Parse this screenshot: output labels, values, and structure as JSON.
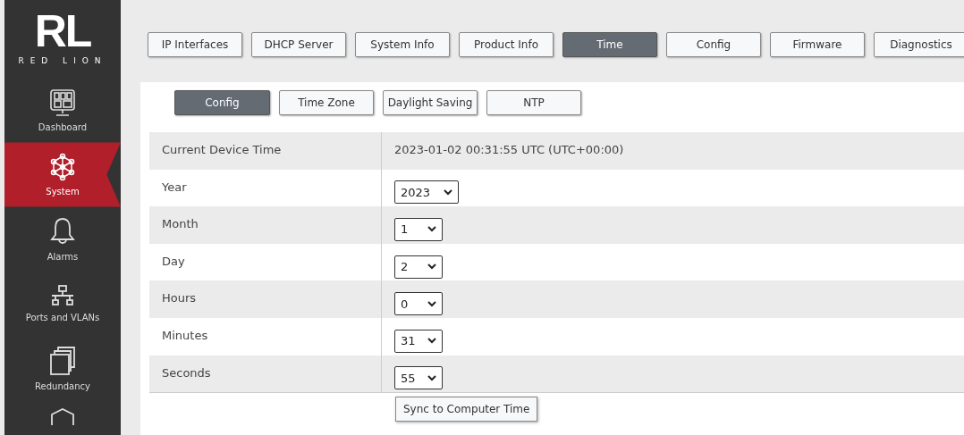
{
  "logo": {
    "mark": "RL",
    "name": "RED LION"
  },
  "sidebar": {
    "items": [
      {
        "label": "Dashboard",
        "selected": false
      },
      {
        "label": "System",
        "selected": true
      },
      {
        "label": "Alarms",
        "selected": false
      },
      {
        "label": "Ports and VLANs",
        "selected": false
      },
      {
        "label": "Redundancy",
        "selected": false
      },
      {
        "selected": false
      }
    ]
  },
  "tabs": [
    {
      "label": "IP Interfaces",
      "selected": false
    },
    {
      "label": "DHCP Server",
      "selected": false
    },
    {
      "label": "System Info",
      "selected": false
    },
    {
      "label": "Product Info",
      "selected": false
    },
    {
      "label": "Time",
      "selected": true
    },
    {
      "label": "Config",
      "selected": false
    },
    {
      "label": "Firmware",
      "selected": false
    },
    {
      "label": "Diagnostics",
      "selected": false
    }
  ],
  "subtabs": [
    {
      "label": "Config",
      "selected": true
    },
    {
      "label": "Time Zone",
      "selected": false
    },
    {
      "label": "Daylight Saving",
      "selected": false
    },
    {
      "label": "NTP",
      "selected": false
    }
  ],
  "table": {
    "rows": [
      {
        "kind": "text",
        "label": "Current Device Time",
        "value": "2023-01-02 00:31:55 UTC (UTC+00:00)"
      },
      {
        "kind": "select",
        "label": "Year",
        "value": "2023"
      },
      {
        "kind": "select",
        "label": "Month",
        "value": "1"
      },
      {
        "kind": "select",
        "label": "Day",
        "value": "2"
      },
      {
        "kind": "select",
        "label": "Hours",
        "value": "0"
      },
      {
        "kind": "select",
        "label": "Minutes",
        "value": "31"
      },
      {
        "kind": "select",
        "label": "Seconds",
        "value": "55"
      }
    ]
  },
  "sync_button": "Sync to Computer Time"
}
